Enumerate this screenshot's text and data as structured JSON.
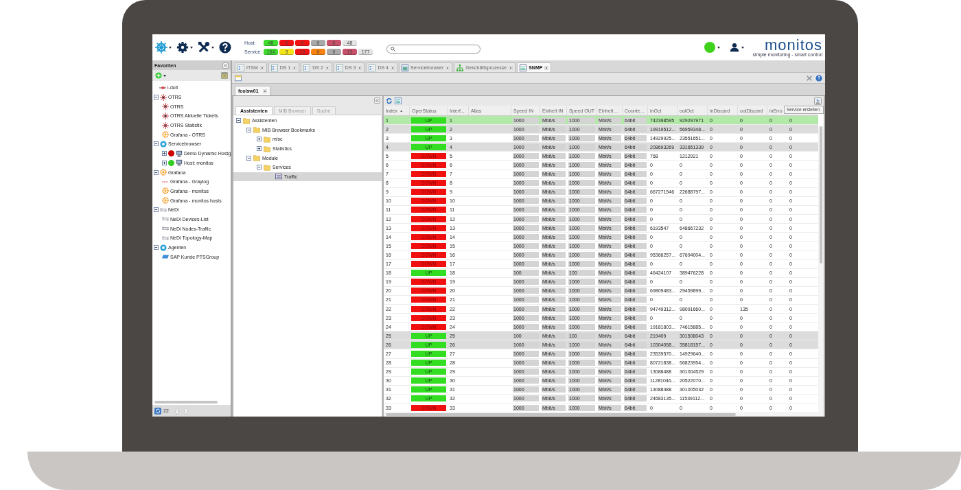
{
  "status_summary": {
    "host_label": "Host:",
    "host": [
      {
        "count": "48",
        "color": "#3ddc2e"
      },
      {
        "count": "0",
        "color": "#f01414"
      },
      {
        "count": "0",
        "color": "#f01414"
      },
      {
        "count": "0",
        "color": "#a9a9a9"
      },
      {
        "count": "0",
        "color": "#c8506a"
      },
      {
        "count": "48",
        "color": "#e4e4e4"
      }
    ],
    "service_label": "Service:",
    "service": [
      {
        "count": "164",
        "color": "#3ddc2e"
      },
      {
        "count": "3",
        "color": "#f5e61a"
      },
      {
        "count": "10",
        "color": "#f01414"
      },
      {
        "count": "0",
        "color": "#f7820f"
      },
      {
        "count": "0",
        "color": "#a9a9a9"
      },
      {
        "count": "13",
        "color": "#c8506a"
      },
      {
        "count": "177",
        "color": "#e4e4e4"
      }
    ]
  },
  "logo": {
    "name": "monitos",
    "tagline": "simple monitoring - smart control"
  },
  "sidebar": {
    "title": "Favoriten",
    "tree": [
      {
        "label": "i-doit",
        "kind": "idoit"
      },
      {
        "label": "OTRS",
        "kind": "otrs",
        "expanded": true,
        "children": [
          {
            "label": "OTRS",
            "kind": "otrs"
          },
          {
            "label": "OTRS Aktuelle Tickets",
            "kind": "otrs"
          },
          {
            "label": "OTRS Statistik",
            "kind": "otrs"
          },
          {
            "label": "Grafana - OTRS",
            "kind": "grafana"
          }
        ]
      },
      {
        "label": "Servicebrowser",
        "kind": "gear",
        "expanded": true,
        "children": [
          {
            "label": "Demo Dynamic Hostg",
            "kind": "host",
            "color": "#cc0000",
            "expanded": false
          },
          {
            "label": "Host: monitos",
            "kind": "host",
            "color": "#33cc22",
            "expanded": false
          }
        ]
      },
      {
        "label": "Grafana",
        "kind": "grafana",
        "expanded": true,
        "children": [
          {
            "label": "Grafana - Graylog",
            "kind": "graylog"
          },
          {
            "label": "Grafana - monitos",
            "kind": "grafana"
          },
          {
            "label": "Grafana - monitos hosts",
            "kind": "grafana"
          }
        ]
      },
      {
        "label": "NeDi",
        "kind": "nedi",
        "expanded": true,
        "children": [
          {
            "label": "NeDi Devices-List",
            "kind": "nedi"
          },
          {
            "label": "NeDi Nodes-Traffic",
            "kind": "nedi"
          },
          {
            "label": "NeDi Topology-Map",
            "kind": "nedi"
          }
        ]
      },
      {
        "label": "Agenten",
        "kind": "gear",
        "expanded": true,
        "children": [
          {
            "label": "SAP Kunde PTSGroup",
            "kind": "sap"
          }
        ]
      }
    ],
    "footer_count": "22"
  },
  "tabs": [
    {
      "label": "ITSM",
      "kind": "dash",
      "selected": false
    },
    {
      "label": "DS 1",
      "kind": "dash",
      "selected": false
    },
    {
      "label": "DS 2",
      "kind": "dash",
      "selected": false
    },
    {
      "label": "DS 3",
      "kind": "dash",
      "selected": false
    },
    {
      "label": "DS 4",
      "kind": "dash",
      "selected": false
    },
    {
      "label": "Servicebrowser",
      "kind": "browser",
      "selected": false
    },
    {
      "label": "Geschäftsprozesse",
      "kind": "process",
      "selected": false
    },
    {
      "label": "SNMP",
      "kind": "snmp",
      "selected": true
    }
  ],
  "subtab": {
    "label": "fcolsw01"
  },
  "assistant": {
    "tabs": [
      {
        "label": "Assistenten",
        "selected": true
      },
      {
        "label": "MIB Browser",
        "selected": false
      },
      {
        "label": "Suche",
        "selected": false
      }
    ],
    "tree": [
      {
        "label": "Assistenten",
        "expanded": true,
        "children": [
          {
            "label": "MIB Browser Bookmarks",
            "expanded": true,
            "children": [
              {
                "label": "misc",
                "expanded": false
              },
              {
                "label": "Statistics",
                "expanded": false
              }
            ]
          },
          {
            "label": "Module",
            "expanded": true,
            "children": [
              {
                "label": "Services",
                "expanded": true,
                "children": [
                  {
                    "label": "Traffic",
                    "kind": "leaf",
                    "selected": true
                  }
                ]
              }
            ]
          }
        ]
      }
    ]
  },
  "grid": {
    "tooltip": "Service erstellen",
    "columns": [
      {
        "label": "Index",
        "sort_mark": "▲",
        "kind": "text"
      },
      {
        "label": "OperStatus",
        "kind": "status"
      },
      {
        "label": "Interf...",
        "kind": "text"
      },
      {
        "label": "Alias",
        "kind": "text"
      },
      {
        "label": "Speed IN",
        "kind": "editable"
      },
      {
        "label": "Einheit IN",
        "kind": "editable"
      },
      {
        "label": "Speed OUT",
        "kind": "editable"
      },
      {
        "label": "Einheit ...",
        "kind": "editable"
      },
      {
        "label": "Counte...",
        "kind": "editable"
      },
      {
        "label": "inOct",
        "kind": "text"
      },
      {
        "label": "outOct",
        "kind": "text"
      },
      {
        "label": "inDiscard",
        "kind": "text"
      },
      {
        "label": "outDiscard",
        "kind": "text"
      },
      {
        "label": "inErro",
        "kind": "text"
      },
      {
        "kind": "text"
      }
    ],
    "rows": [
      {
        "selected": true,
        "marked": false,
        "up": true,
        "cells": [
          "1",
          "UP",
          "1",
          "",
          "1000",
          "Mbit/s",
          "1000",
          "Mbit/s",
          "64bit",
          "742398595",
          "929297971",
          "0",
          "0",
          "0",
          "0"
        ]
      },
      {
        "selected": false,
        "marked": true,
        "up": true,
        "cells": [
          "2",
          "UP",
          "2",
          "",
          "1000",
          "Mbit/s",
          "1000",
          "Mbit/s",
          "64bit",
          "19919512...",
          "56959348...",
          "0",
          "0",
          "0",
          "0"
        ]
      },
      {
        "selected": false,
        "marked": false,
        "up": true,
        "cells": [
          "3",
          "UP",
          "3",
          "",
          "1000",
          "Mbit/s",
          "1000",
          "Mbit/s",
          "64bit",
          "14929925...",
          "23551651...",
          "0",
          "0",
          "0",
          "0"
        ]
      },
      {
        "selected": false,
        "marked": true,
        "up": true,
        "cells": [
          "4",
          "UP",
          "4",
          "",
          "1000",
          "Mbit/s",
          "1000",
          "Mbit/s",
          "64bit",
          "208693269",
          "331651339",
          "0",
          "0",
          "0",
          "0"
        ]
      },
      {
        "selected": false,
        "marked": false,
        "up": false,
        "cells": [
          "5",
          "DOWN",
          "5",
          "",
          "1000",
          "Mbit/s",
          "1000",
          "Mbit/s",
          "64bit",
          "768",
          "1212921",
          "0",
          "0",
          "0",
          "0"
        ]
      },
      {
        "selected": false,
        "marked": false,
        "up": false,
        "cells": [
          "6",
          "DOWN",
          "6",
          "",
          "1000",
          "Mbit/s",
          "1000",
          "Mbit/s",
          "64bit",
          "0",
          "0",
          "0",
          "0",
          "0",
          "0"
        ]
      },
      {
        "selected": false,
        "marked": false,
        "up": false,
        "cells": [
          "7",
          "DOWN",
          "7",
          "",
          "1000",
          "Mbit/s",
          "1000",
          "Mbit/s",
          "64bit",
          "0",
          "0",
          "0",
          "0",
          "0",
          "0"
        ]
      },
      {
        "selected": false,
        "marked": false,
        "up": false,
        "cells": [
          "8",
          "DOWN",
          "8",
          "",
          "1000",
          "Mbit/s",
          "1000",
          "Mbit/s",
          "64bit",
          "0",
          "0",
          "0",
          "0",
          "0",
          "0"
        ]
      },
      {
        "selected": false,
        "marked": false,
        "up": false,
        "cells": [
          "9",
          "DOWN",
          "9",
          "",
          "1000",
          "Mbit/s",
          "1000",
          "Mbit/s",
          "64bit",
          "667271546",
          "22688797...",
          "0",
          "0",
          "0",
          "0"
        ]
      },
      {
        "selected": false,
        "marked": false,
        "up": false,
        "cells": [
          "10",
          "DOWN",
          "10",
          "",
          "1000",
          "Mbit/s",
          "1000",
          "Mbit/s",
          "64bit",
          "0",
          "0",
          "0",
          "0",
          "0",
          "0"
        ]
      },
      {
        "selected": false,
        "marked": false,
        "up": false,
        "cells": [
          "11",
          "DOWN",
          "11",
          "",
          "1000",
          "Mbit/s",
          "1000",
          "Mbit/s",
          "64bit",
          "0",
          "0",
          "0",
          "0",
          "0",
          "0"
        ]
      },
      {
        "selected": false,
        "marked": false,
        "up": false,
        "cells": [
          "12",
          "DOWN",
          "12",
          "",
          "1000",
          "Mbit/s",
          "1000",
          "Mbit/s",
          "64bit",
          "0",
          "0",
          "0",
          "0",
          "0",
          "0"
        ]
      },
      {
        "selected": false,
        "marked": false,
        "up": false,
        "cells": [
          "13",
          "DOWN",
          "13",
          "",
          "1000",
          "Mbit/s",
          "1000",
          "Mbit/s",
          "64bit",
          "6193547",
          "648667232",
          "0",
          "0",
          "0",
          "0"
        ]
      },
      {
        "selected": false,
        "marked": false,
        "up": false,
        "cells": [
          "14",
          "DOWN",
          "14",
          "",
          "1000",
          "Mbit/s",
          "1000",
          "Mbit/s",
          "64bit",
          "0",
          "0",
          "0",
          "0",
          "0",
          "0"
        ]
      },
      {
        "selected": false,
        "marked": false,
        "up": false,
        "cells": [
          "15",
          "DOWN",
          "15",
          "",
          "1000",
          "Mbit/s",
          "1000",
          "Mbit/s",
          "64bit",
          "0",
          "0",
          "0",
          "0",
          "0",
          "0"
        ]
      },
      {
        "selected": false,
        "marked": false,
        "up": false,
        "cells": [
          "16",
          "DOWN",
          "16",
          "",
          "1000",
          "Mbit/s",
          "1000",
          "Mbit/s",
          "64bit",
          "95366257...",
          "67694004...",
          "0",
          "0",
          "0",
          "0"
        ]
      },
      {
        "selected": false,
        "marked": false,
        "up": false,
        "cells": [
          "17",
          "DOWN",
          "17",
          "",
          "1000",
          "Mbit/s",
          "1000",
          "Mbit/s",
          "64bit",
          "0",
          "0",
          "0",
          "0",
          "0",
          "0"
        ]
      },
      {
        "selected": false,
        "marked": false,
        "up": true,
        "cells": [
          "18",
          "UP",
          "18",
          "",
          "100",
          "Mbit/s",
          "100",
          "Mbit/s",
          "64bit",
          "46424107",
          "389476228",
          "0",
          "0",
          "0",
          "0"
        ]
      },
      {
        "selected": false,
        "marked": false,
        "up": false,
        "cells": [
          "19",
          "DOWN",
          "19",
          "",
          "1000",
          "Mbit/s",
          "1000",
          "Mbit/s",
          "64bit",
          "0",
          "0",
          "0",
          "0",
          "0",
          "0"
        ]
      },
      {
        "selected": false,
        "marked": false,
        "up": false,
        "cells": [
          "20",
          "DOWN",
          "20",
          "",
          "1000",
          "Mbit/s",
          "1000",
          "Mbit/s",
          "64bit",
          "69809483...",
          "29459899...",
          "0",
          "0",
          "0",
          "0"
        ]
      },
      {
        "selected": false,
        "marked": false,
        "up": false,
        "cells": [
          "21",
          "DOWN",
          "21",
          "",
          "1000",
          "Mbit/s",
          "1000",
          "Mbit/s",
          "64bit",
          "0",
          "0",
          "0",
          "0",
          "0",
          "0"
        ]
      },
      {
        "selected": false,
        "marked": false,
        "up": false,
        "cells": [
          "22",
          "DOWN",
          "22",
          "",
          "1000",
          "Mbit/s",
          "1000",
          "Mbit/s",
          "64bit",
          "94749312...",
          "98091660...",
          "0",
          "135",
          "0",
          "0"
        ]
      },
      {
        "selected": false,
        "marked": false,
        "up": false,
        "cells": [
          "23",
          "DOWN",
          "23",
          "",
          "1000",
          "Mbit/s",
          "1000",
          "Mbit/s",
          "64bit",
          "0",
          "0",
          "0",
          "0",
          "0",
          "0"
        ]
      },
      {
        "selected": false,
        "marked": false,
        "up": false,
        "cells": [
          "24",
          "DOWN",
          "24",
          "",
          "1000",
          "Mbit/s",
          "1000",
          "Mbit/s",
          "64bit",
          "19181803...",
          "74615885...",
          "0",
          "0",
          "0",
          "0"
        ]
      },
      {
        "selected": false,
        "marked": true,
        "up": true,
        "cells": [
          "25",
          "UP",
          "25",
          "",
          "100",
          "Mbit/s",
          "100",
          "Mbit/s",
          "64bit",
          "219409",
          "301508043",
          "0",
          "0",
          "0",
          "0"
        ]
      },
      {
        "selected": false,
        "marked": true,
        "up": true,
        "cells": [
          "26",
          "UP",
          "26",
          "",
          "1000",
          "Mbit/s",
          "1000",
          "Mbit/s",
          "64bit",
          "10304058...",
          "35818157...",
          "0",
          "0",
          "0",
          "0"
        ]
      },
      {
        "selected": false,
        "marked": false,
        "up": true,
        "cells": [
          "27",
          "UP",
          "27",
          "",
          "1000",
          "Mbit/s",
          "1000",
          "Mbit/s",
          "64bit",
          "23539570...",
          "14929640...",
          "0",
          "0",
          "0",
          "0"
        ]
      },
      {
        "selected": false,
        "marked": false,
        "up": true,
        "cells": [
          "28",
          "UP",
          "28",
          "",
          "1000",
          "Mbit/s",
          "1000",
          "Mbit/s",
          "64bit",
          "80721838...",
          "56823954...",
          "0",
          "0",
          "0",
          "0"
        ]
      },
      {
        "selected": false,
        "marked": false,
        "up": true,
        "cells": [
          "29",
          "UP",
          "29",
          "",
          "1000",
          "Mbit/s",
          "1000",
          "Mbit/s",
          "64bit",
          "13088488",
          "301004529",
          "0",
          "0",
          "0",
          "0"
        ]
      },
      {
        "selected": false,
        "marked": false,
        "up": true,
        "cells": [
          "30",
          "UP",
          "30",
          "",
          "1000",
          "Mbit/s",
          "1000",
          "Mbit/s",
          "64bit",
          "11281046...",
          "20522070...",
          "0",
          "0",
          "0",
          "0"
        ]
      },
      {
        "selected": false,
        "marked": false,
        "up": true,
        "cells": [
          "31",
          "UP",
          "31",
          "",
          "1000",
          "Mbit/s",
          "1000",
          "Mbit/s",
          "64bit",
          "13088488",
          "301005032",
          "0",
          "0",
          "0",
          "0"
        ]
      },
      {
        "selected": false,
        "marked": false,
        "up": true,
        "cells": [
          "32",
          "UP",
          "32",
          "",
          "1000",
          "Mbit/s",
          "1000",
          "Mbit/s",
          "64bit",
          "24683135...",
          "11539112...",
          "0",
          "0",
          "0",
          "0"
        ]
      },
      {
        "selected": false,
        "marked": false,
        "up": false,
        "cells": [
          "33",
          "DOWN",
          "33",
          "",
          "1000",
          "Mbit/s",
          "1000",
          "Mbit/s",
          "64bit",
          "0",
          "0",
          "0",
          "0",
          "0",
          "0"
        ]
      }
    ]
  }
}
